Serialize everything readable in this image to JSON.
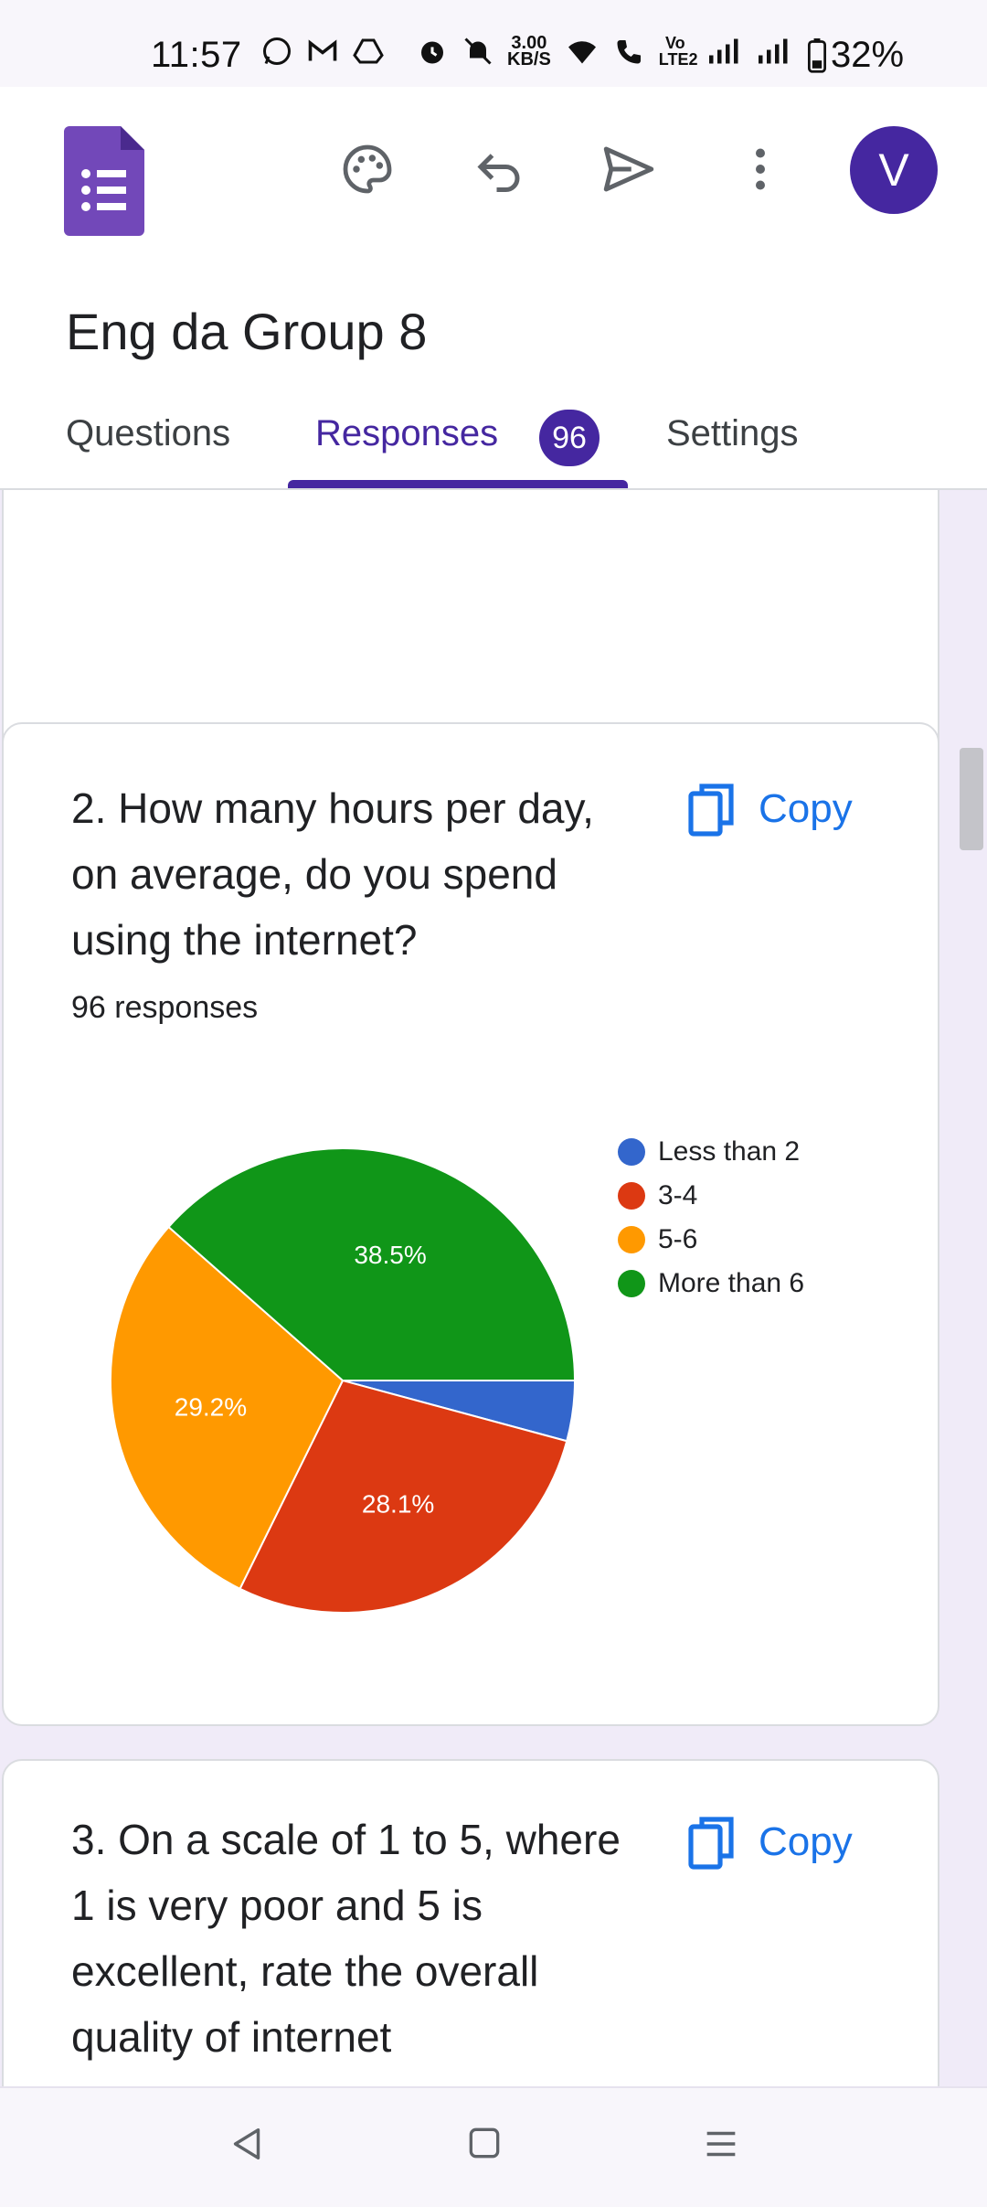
{
  "status_bar": {
    "time": "11:57",
    "net_speed_value": "3.00",
    "net_speed_unit": "KB/S",
    "volte": "Vo LTE2",
    "battery": "32%"
  },
  "toolbar": {
    "app_icon": "google-forms-icon",
    "palette_icon": "palette-icon",
    "undo_icon": "undo-icon",
    "send_icon": "send-icon",
    "more_icon": "more-vert-icon",
    "avatar_letter": "V",
    "avatar_color": "#4527a0"
  },
  "form": {
    "title": "Eng da Group 8"
  },
  "tabs": [
    {
      "label": "Questions",
      "active": false
    },
    {
      "label": "Responses",
      "active": true,
      "badge": "96"
    },
    {
      "label": "Settings",
      "active": false
    }
  ],
  "questions": [
    {
      "text": "2. How many hours per day, on average, do you spend using the internet?",
      "copy_label": "Copy",
      "responses_label": "96 responses"
    },
    {
      "text": "3. On a scale of 1 to 5, where 1 is very poor and 5 is excellent, rate the overall quality of internet",
      "copy_label": "Copy"
    }
  ],
  "chart_data": {
    "type": "pie",
    "categories": [
      "Less than 2",
      "3-4",
      "5-6",
      "More than 6"
    ],
    "values": [
      4.2,
      28.1,
      29.2,
      38.5
    ],
    "value_labels": [
      "",
      "28.1%",
      "29.2%",
      "38.5%"
    ],
    "colors": [
      "#3366cc",
      "#dc3912",
      "#ff9900",
      "#109618"
    ],
    "legend_position": "right"
  },
  "previous_chart_color": "#dc3912",
  "nav": {
    "back_icon": "back-triangle-icon",
    "home_icon": "home-square-icon",
    "menu_icon": "menu-lines-icon"
  }
}
